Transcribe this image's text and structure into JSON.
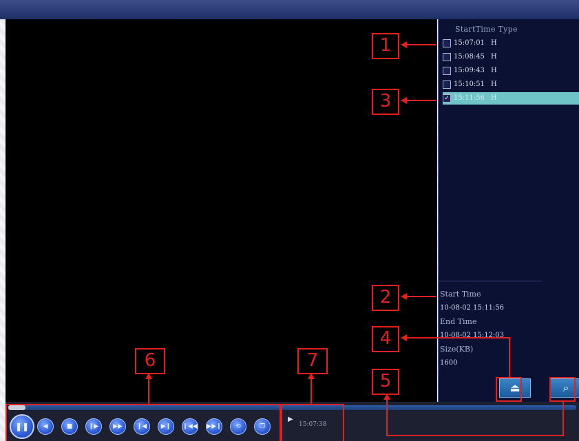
{
  "panel": {
    "header": "StartTime Type",
    "records": [
      {
        "time": "15:07:01",
        "type": "H",
        "checked": false,
        "selected": false
      },
      {
        "time": "15:08:45",
        "type": "H",
        "checked": false,
        "selected": false
      },
      {
        "time": "15:09:43",
        "type": "H",
        "checked": false,
        "selected": false
      },
      {
        "time": "15:10:51",
        "type": "H",
        "checked": false,
        "selected": false
      },
      {
        "time": "15:11:56",
        "type": "H",
        "checked": true,
        "selected": true
      }
    ],
    "info": {
      "start_label": "Start Time",
      "start_value": "10-08-02 15:11:56",
      "end_label": "End Time",
      "end_value": "10-08-02 15:12:03",
      "size_label": "Size(KB)",
      "size_value": "1600"
    },
    "buttons": {
      "backup_icon": "backup-icon",
      "search_icon": "search-icon"
    }
  },
  "playback": {
    "current_time": "15:07:38",
    "progress": 0.03,
    "controls": [
      {
        "name": "pause-button",
        "glyph": "❚❚"
      },
      {
        "name": "reverse-button",
        "glyph": "◀"
      },
      {
        "name": "stop-button",
        "glyph": "■"
      },
      {
        "name": "step-button",
        "glyph": "❙▶"
      },
      {
        "name": "fast-forward-button",
        "glyph": "▶▶"
      },
      {
        "name": "previous-frame-button",
        "glyph": "❙◀"
      },
      {
        "name": "next-frame-button",
        "glyph": "▶❙"
      },
      {
        "name": "previous-file-button",
        "glyph": "❙◀◀"
      },
      {
        "name": "next-file-button",
        "glyph": "▶▶❙"
      },
      {
        "name": "repeat-button",
        "glyph": "⟲"
      },
      {
        "name": "hide-button",
        "glyph": "❐"
      }
    ]
  },
  "annotations": {
    "n1": "1",
    "n2": "2",
    "n3": "3",
    "n4": "4",
    "n5": "5",
    "n6": "6",
    "n7": "7",
    "color": "#e32020"
  }
}
